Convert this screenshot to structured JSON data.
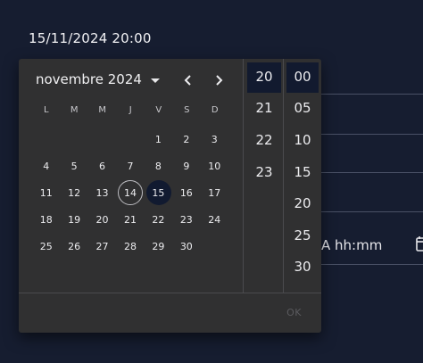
{
  "field": {
    "value": "15/11/2024 20:00"
  },
  "background_field": {
    "placeholder_fragment": "A hh:mm",
    "icon": "calendar-icon"
  },
  "calendar": {
    "month_label": "novembre 2024",
    "weekdays": [
      "L",
      "M",
      "M",
      "J",
      "V",
      "S",
      "D"
    ],
    "weeks": [
      [
        "",
        "",
        "",
        "",
        "1",
        "2",
        "3"
      ],
      [
        "4",
        "5",
        "6",
        "7",
        "8",
        "9",
        "10"
      ],
      [
        "11",
        "12",
        "13",
        "14",
        "15",
        "16",
        "17"
      ],
      [
        "18",
        "19",
        "20",
        "21",
        "22",
        "23",
        "24"
      ],
      [
        "25",
        "26",
        "27",
        "28",
        "29",
        "30",
        ""
      ]
    ],
    "today": "14",
    "selected": "15"
  },
  "time": {
    "hours": [
      "20",
      "21",
      "22",
      "23"
    ],
    "minutes": [
      "00",
      "05",
      "10",
      "15",
      "20",
      "25",
      "30"
    ],
    "selected_hour": "20",
    "selected_minute": "00"
  },
  "actions": {
    "ok_label": "OK"
  },
  "colors": {
    "page_bg": "#161d30",
    "popup_bg": "#303031",
    "selected_bg": "#111a30"
  }
}
